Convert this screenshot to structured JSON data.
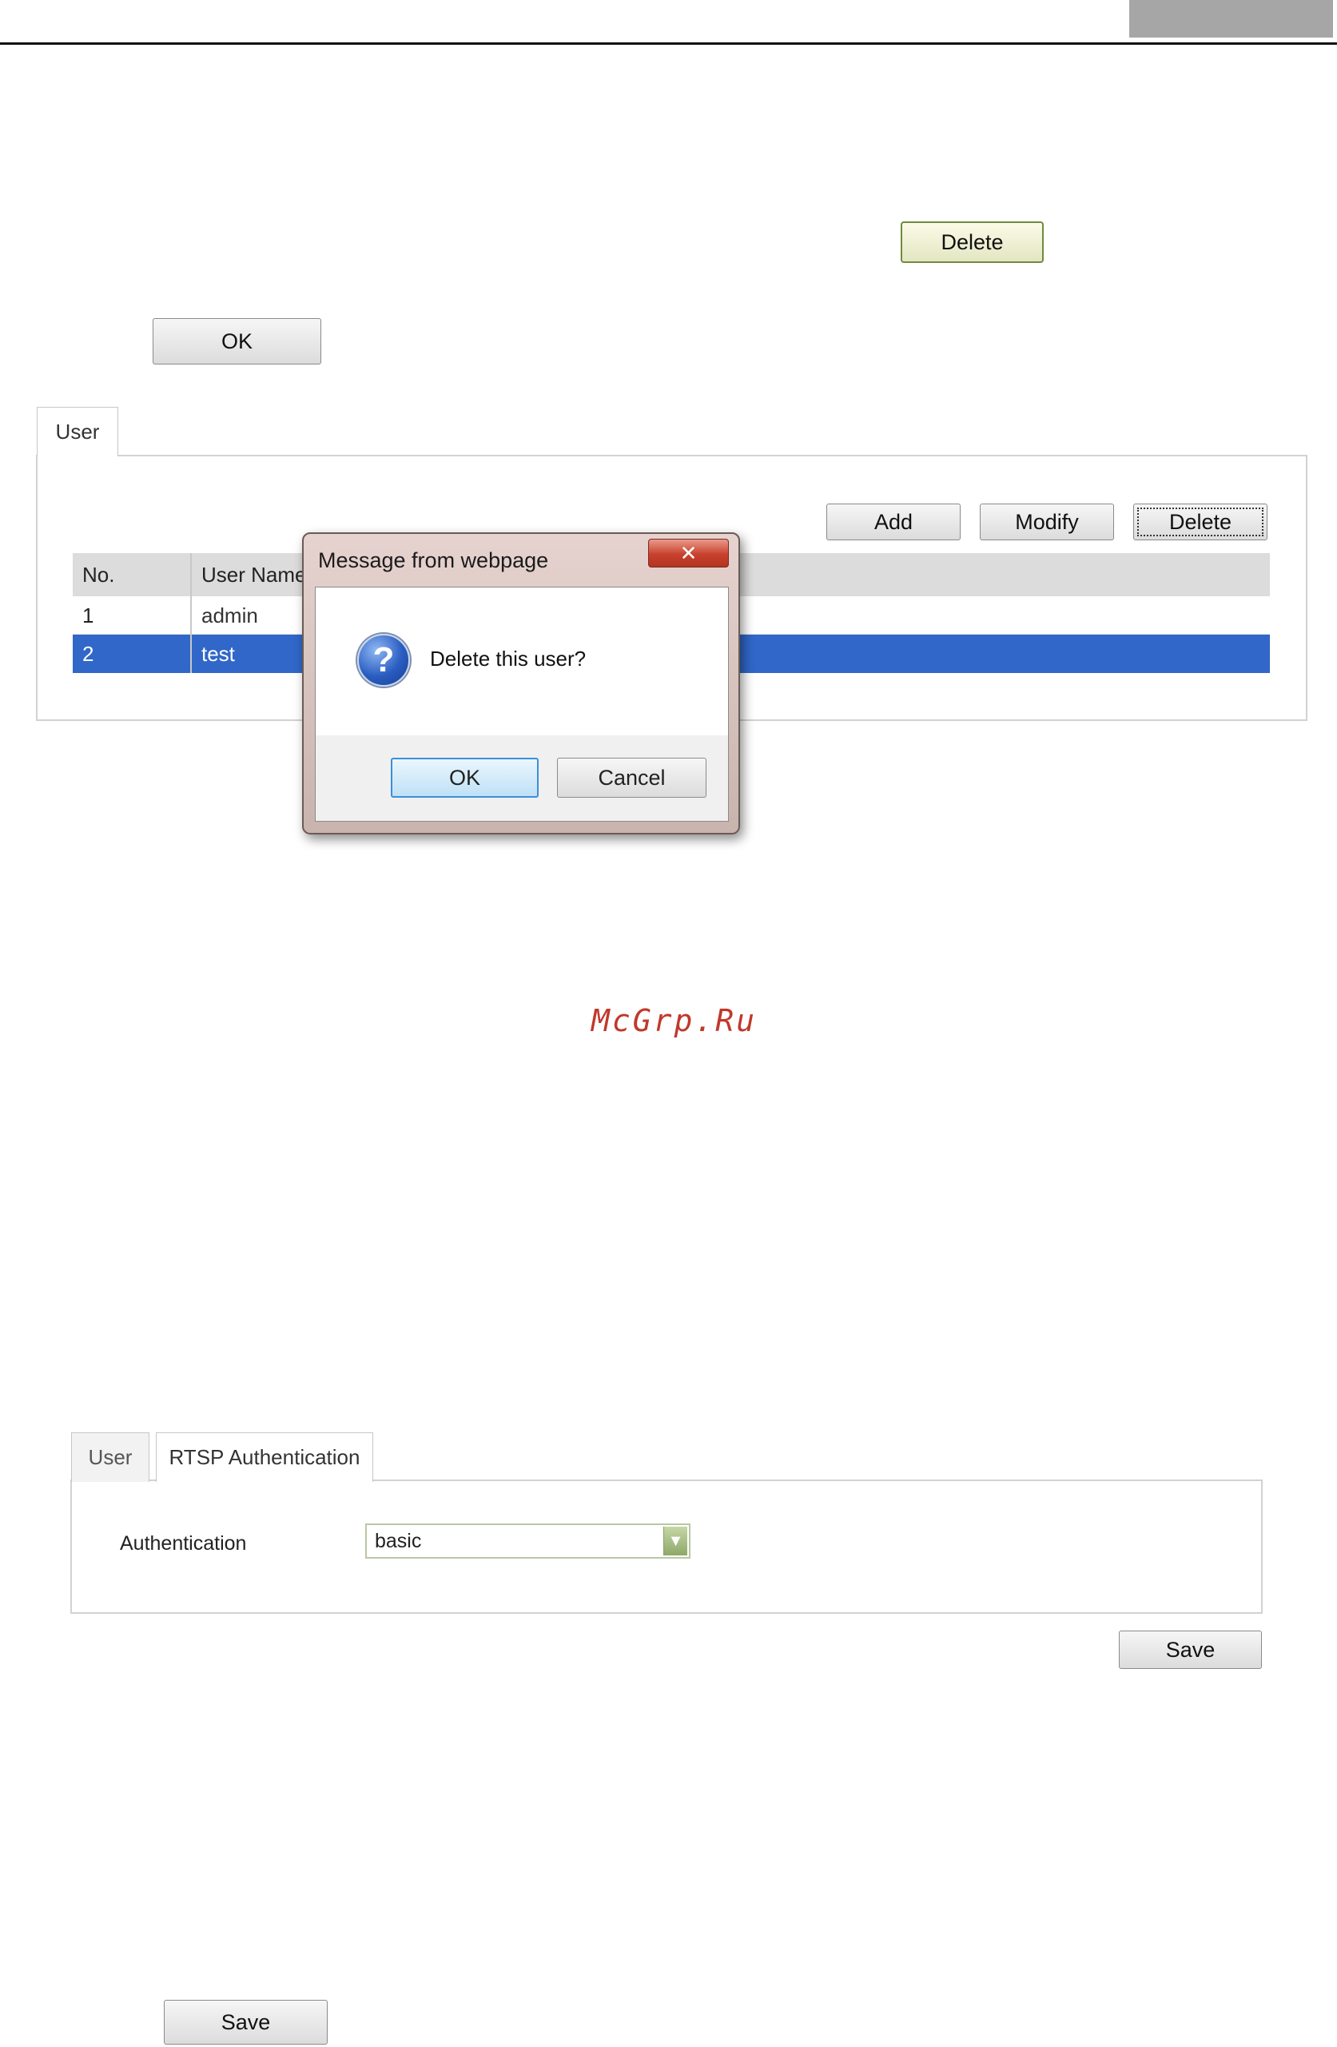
{
  "top_buttons": {
    "delete_label": "Delete",
    "ok_label": "OK"
  },
  "user_panel": {
    "tab_label": "User",
    "buttons": {
      "add": "Add",
      "modify": "Modify",
      "delete": "Delete"
    },
    "columns": [
      "No.",
      "User Name"
    ],
    "rows": [
      {
        "no": "1",
        "name": "admin",
        "selected": false
      },
      {
        "no": "2",
        "name": "test",
        "selected": true
      }
    ]
  },
  "dialog": {
    "title": "Message from webpage",
    "close_glyph": "✕",
    "icon_glyph": "?",
    "message": "Delete this user?",
    "ok_label": "OK",
    "cancel_label": "Cancel"
  },
  "watermark": "McGrp.Ru",
  "rtsp_panel": {
    "tabs": [
      "User",
      "RTSP Authentication"
    ],
    "field_label": "Authentication",
    "select_value": "basic",
    "save_label": "Save"
  },
  "bottom_save_label": "Save",
  "colors": {
    "selected_row": "#3067c8",
    "watermark": "#c0392b",
    "dialog_ok_border": "#3c8fd6"
  }
}
